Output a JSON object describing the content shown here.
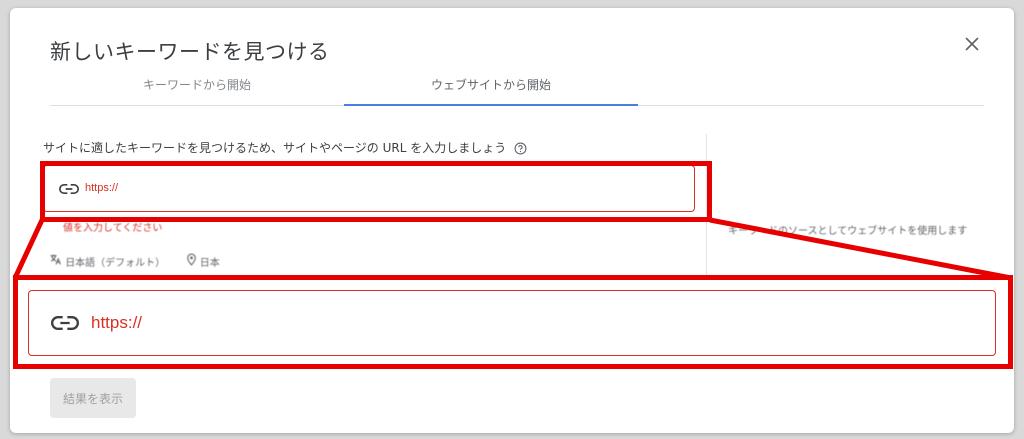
{
  "dialog": {
    "title": "新しいキーワードを見つける",
    "close_icon": "close-icon"
  },
  "tabs": [
    {
      "label": "キーワードから開始",
      "selected": false
    },
    {
      "label": "ウェブサイトから開始",
      "selected": true
    }
  ],
  "form": {
    "instruction": "サイトに適したキーワードを見つけるため、サイトやページの URL を入力しましょう",
    "help_icon": "help-circle-icon",
    "url_value": "https://",
    "link_icon": "link-icon",
    "error_message": "値を入力してください",
    "language": "日本語（デフォルト）",
    "language_icon": "translate-icon",
    "location": "日本",
    "location_icon": "location-pin-icon"
  },
  "side_note": "キーワードのソースとしてウェブサイトを使用します",
  "zoomed_field": {
    "url_value": "https://"
  },
  "results_button": {
    "label": "結果を表示",
    "disabled": true
  },
  "colors": {
    "error": "#d93025",
    "tab_indicator": "#4a7fe0",
    "highlight": "#e60000"
  }
}
